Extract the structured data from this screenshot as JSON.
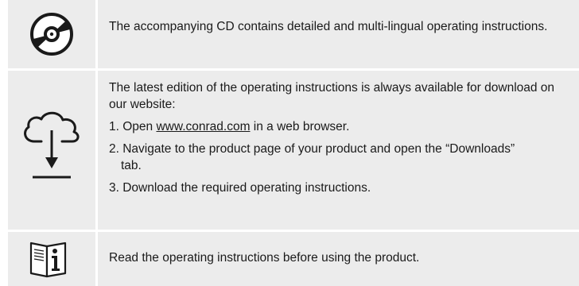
{
  "icons": {
    "cd": "cd-disc-icon",
    "download": "cloud-download-icon",
    "manual": "manual-info-icon"
  },
  "rows": {
    "cd": {
      "text": "The accompanying CD contains detailed and multi-lingual operating instructions."
    },
    "download": {
      "intro": "The latest edition of the operating instructions is always available for download on our website:",
      "step1_prefix": "1. Open ",
      "step1_link": "www.conrad.com",
      "step1_suffix": " in a web browser.",
      "step2_line1": "2. Navigate to the product page of your product and open the “Downloads”",
      "step2_line2": "tab.",
      "step3": "3. Download the required operating instructions."
    },
    "manual": {
      "text": "Read the operating instructions before using the product."
    }
  }
}
